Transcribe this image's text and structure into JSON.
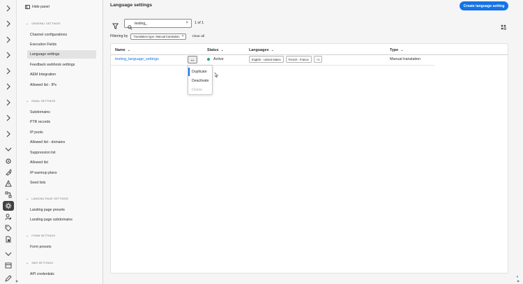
{
  "panel": {
    "hide_label": "Hide panel",
    "sections": [
      {
        "title": "GENERAL SETTINGS",
        "items": [
          "Channel configurations",
          "Execution Fields",
          "Language settings",
          "Feedback webhook settings",
          "AEM Integration",
          "Allowed list - IPs"
        ]
      },
      {
        "title": "EMAIL SETTINGS",
        "items": [
          "Subdomains",
          "PTR records",
          "IP pools",
          "Allowed list - domains",
          "Suppression list",
          "Allowed list",
          "IP warmup plans",
          "Seed lists"
        ]
      },
      {
        "title": "LANDING PAGE SETTINGS",
        "items": [
          "Landing page presets",
          "Landing page subdomains"
        ]
      },
      {
        "title": "FORM SETTINGS",
        "items": [
          "Form presets"
        ]
      },
      {
        "title": "SMS SETTINGS",
        "items": [
          "API credentials"
        ]
      }
    ],
    "selected_item": "Language settings"
  },
  "main": {
    "title": "Language settings",
    "create_button": "Create language setting",
    "search_value": "testing_",
    "result_count": "1 of 1",
    "filtering_label": "Filtering by",
    "filter_chip": "Translation type: Manual translation",
    "clear_all": "Clear all",
    "columns": {
      "name": "Name",
      "status": "Status",
      "languages": "Languages",
      "type": "Type"
    },
    "row": {
      "name": "testing_language_settings",
      "status": "Active",
      "languages": [
        "English - United States",
        "French - France",
        "+1"
      ],
      "type": "Manual translation"
    },
    "more_actions": "...",
    "menu": {
      "duplicate": "Duplicate",
      "deactivate": "Deactivate",
      "delete": "Delete"
    }
  },
  "colors": {
    "accent": "#1473e6",
    "active_status": "#2d9d78"
  }
}
